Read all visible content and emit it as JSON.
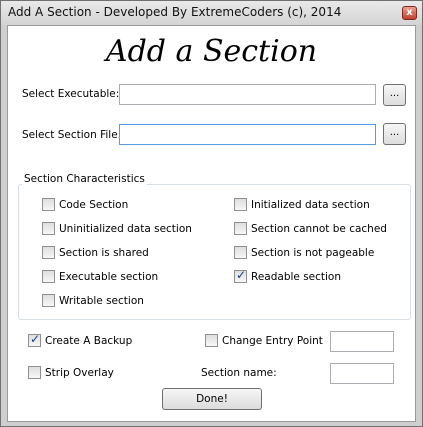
{
  "window": {
    "title": "Add A Section - Developed By ExtremeCoders (c), 2014",
    "close_glyph": "x"
  },
  "heading": "Add a Section",
  "executable": {
    "label": "Select Executable:",
    "value": "",
    "browse_label": "..."
  },
  "section_file": {
    "label": "Select Section File:",
    "value": "",
    "browse_label": "..."
  },
  "characteristics": {
    "title": "Section Characteristics",
    "left": [
      {
        "label": "Code Section",
        "checked": false
      },
      {
        "label": "Uninitialized data section",
        "checked": false
      },
      {
        "label": "Section is shared",
        "checked": false
      },
      {
        "label": "Executable section",
        "checked": false
      },
      {
        "label": "Writable section",
        "checked": false
      }
    ],
    "right": [
      {
        "label": "Initialized data section",
        "checked": false
      },
      {
        "label": "Section cannot be cached",
        "checked": false
      },
      {
        "label": "Section is not pageable",
        "checked": false
      },
      {
        "label": "Readable section",
        "checked": true
      }
    ]
  },
  "options": {
    "create_backup": {
      "label": "Create A Backup",
      "checked": true
    },
    "strip_overlay": {
      "label": "Strip Overlay",
      "checked": false
    },
    "change_entry": {
      "label": "Change Entry Point",
      "checked": false,
      "value": ""
    },
    "section_name": {
      "label": "Section name:",
      "value": ""
    }
  },
  "done_label": "Done!"
}
